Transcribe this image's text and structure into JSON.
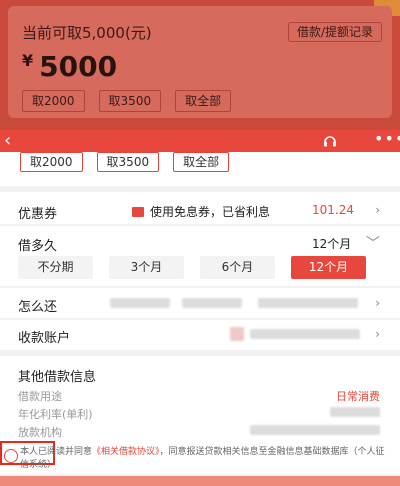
{
  "top": {
    "title": "当前可取5,000(元)",
    "record_label": "借款/提额记录",
    "currency": "¥",
    "amount": "5000",
    "chips": [
      "取2000",
      "取3500",
      "取全部"
    ]
  },
  "header": {
    "back_icon": "‹",
    "headset_icon": "headset-icon",
    "more_icon": "•••"
  },
  "chips": [
    "取2000",
    "取3500",
    "取全部"
  ],
  "coupon": {
    "label": "优惠券",
    "text": "使用免息券，已省利息",
    "value": "101.24"
  },
  "term": {
    "label": "借多久",
    "selected": "12个月",
    "options": [
      "不分期",
      "3个月",
      "6个月",
      "12个月"
    ]
  },
  "repay": {
    "label": "怎么还"
  },
  "account": {
    "label": "收款账户"
  },
  "info": {
    "title": "其他借款信息",
    "rows": [
      {
        "label": "借款用途",
        "value": "日常消费"
      },
      {
        "label": "年化利率(单利)",
        "value": ""
      },
      {
        "label": "放款机构",
        "value": ""
      }
    ]
  },
  "agreement": {
    "prefix": "本人已阅读并同意",
    "link": "《相关借款协议》",
    "suffix": "，同意报送贷款相关信息至金融信息基础数据库（个人征信系统）"
  },
  "colors": {
    "accent": "#e8473d"
  }
}
